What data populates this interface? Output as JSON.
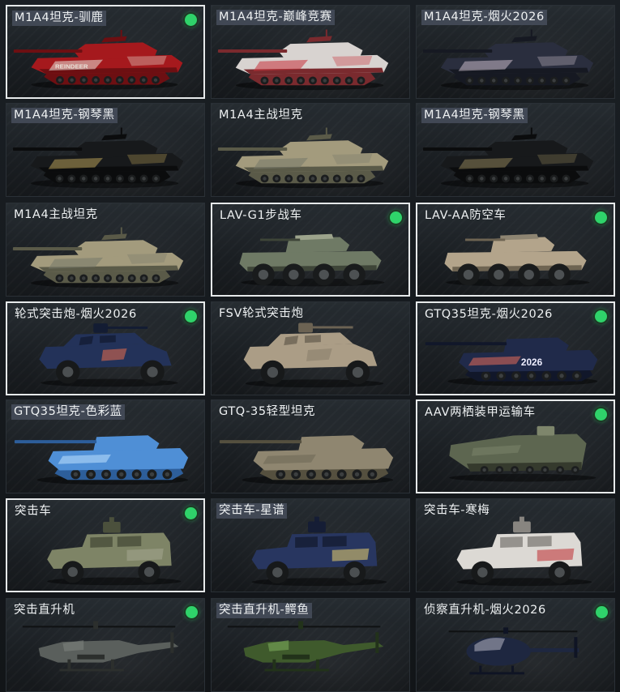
{
  "grid": {
    "cards": [
      {
        "label": "M1A4坦克-驯鹿",
        "selected": true,
        "owned": true,
        "label_hl": true,
        "kind": "tank",
        "body": "#a5191d",
        "dark": "#6d0f12",
        "accent": "#e8e2d8",
        "decal": "REINDEER"
      },
      {
        "label": "M1A4坦克-巅峰竞赛",
        "selected": false,
        "owned": false,
        "label_hl": true,
        "kind": "tank",
        "body": "#d8d3d0",
        "dark": "#7a2a2e",
        "accent": "#c8323a",
        "decal": ""
      },
      {
        "label": "M1A4坦克-烟火2026",
        "selected": false,
        "owned": false,
        "label_hl": true,
        "kind": "tank",
        "body": "#2a2e3e",
        "dark": "#161922",
        "accent": "#c7b9c6",
        "decal": ""
      },
      {
        "label": "M1A4坦克-钢琴黑",
        "selected": false,
        "owned": false,
        "label_hl": true,
        "kind": "tank",
        "body": "#17191b",
        "dark": "#0b0c0d",
        "accent": "#b39a55",
        "decal": ""
      },
      {
        "label": "M1A4主战坦克",
        "selected": false,
        "owned": false,
        "label_hl": false,
        "kind": "tank",
        "body": "#a39b7d",
        "dark": "#5a5a48",
        "accent": "#77796a",
        "decal": ""
      },
      {
        "label": "M1A4坦克-钢琴黑",
        "selected": false,
        "owned": false,
        "label_hl": true,
        "kind": "tank",
        "body": "#17191b",
        "dark": "#0b0c0d",
        "accent": "#8a7d55",
        "decal": ""
      },
      {
        "label": "M1A4主战坦克",
        "selected": false,
        "owned": false,
        "label_hl": false,
        "kind": "tank",
        "body": "#a39b7d",
        "dark": "#5a5a48",
        "accent": "#77796a",
        "decal": ""
      },
      {
        "label": "LAV-G1步战车",
        "selected": true,
        "owned": true,
        "label_hl": false,
        "kind": "apc",
        "body": "#6f7a65",
        "dark": "#3e4538",
        "accent": "#9da48c",
        "decal": ""
      },
      {
        "label": "LAV-AA防空车",
        "selected": true,
        "owned": true,
        "label_hl": false,
        "kind": "apc",
        "body": "#b3a48b",
        "dark": "#6e6452",
        "accent": "#8e8572",
        "decal": ""
      },
      {
        "label": "轮式突击炮-烟火2026",
        "selected": true,
        "owned": true,
        "label_hl": false,
        "kind": "car4",
        "body": "#233259",
        "dark": "#131c33",
        "accent": "#d7674f",
        "decal": ""
      },
      {
        "label": "FSV轮式突击炮",
        "selected": false,
        "owned": false,
        "label_hl": false,
        "kind": "car4",
        "body": "#ab9d86",
        "dark": "#6c6353",
        "accent": "#8a7f6c",
        "decal": ""
      },
      {
        "label": "GTQ35坦克-烟火2026",
        "selected": true,
        "owned": true,
        "label_hl": false,
        "kind": "light",
        "body": "#202a4a",
        "dark": "#11172a",
        "accent": "#e46a5a",
        "decal": "2026"
      },
      {
        "label": "GTQ35坦克-色彩蓝",
        "selected": false,
        "owned": false,
        "label_hl": true,
        "kind": "light",
        "body": "#4f8fd6",
        "dark": "#2d5e9a",
        "accent": "#bfe2ff",
        "decal": ""
      },
      {
        "label": "GTQ-35轻型坦克",
        "selected": false,
        "owned": false,
        "label_hl": false,
        "kind": "light",
        "body": "#8f8670",
        "dark": "#55503f",
        "accent": "#6d6756",
        "decal": ""
      },
      {
        "label": "AAV两栖装甲运输车",
        "selected": true,
        "owned": true,
        "label_hl": false,
        "kind": "aav",
        "body": "#5d6650",
        "dark": "#353a2d",
        "accent": "#7e866c",
        "decal": ""
      },
      {
        "label": "突击车",
        "selected": true,
        "owned": true,
        "label_hl": false,
        "kind": "truck",
        "body": "#7e8466",
        "dark": "#4b503c",
        "accent": "#a2a48c",
        "decal": ""
      },
      {
        "label": "突击车-星谱",
        "selected": false,
        "owned": false,
        "label_hl": true,
        "kind": "truck",
        "body": "#283660",
        "dark": "#151d35",
        "accent": "#d9c46e",
        "decal": ""
      },
      {
        "label": "突击车-寒梅",
        "selected": false,
        "owned": false,
        "label_hl": false,
        "kind": "truck",
        "body": "#dcd9d4",
        "dark": "#888580",
        "accent": "#c23b3e",
        "decal": ""
      },
      {
        "label": "突击直升机",
        "selected": false,
        "owned": true,
        "label_hl": false,
        "kind": "heli",
        "body": "#5a5f5c",
        "dark": "#2c2f2d",
        "accent": "#7b807c",
        "decal": ""
      },
      {
        "label": "突击直升机-鳄鱼",
        "selected": false,
        "owned": false,
        "label_hl": true,
        "kind": "heli",
        "body": "#3f5a2c",
        "dark": "#22321a",
        "accent": "#79a85a",
        "decal": ""
      },
      {
        "label": "侦察直升机-烟火2026",
        "selected": false,
        "owned": true,
        "label_hl": false,
        "kind": "scout",
        "body": "#1e2740",
        "dark": "#0f1424",
        "accent": "#d8d4e0",
        "decal": ""
      }
    ]
  }
}
